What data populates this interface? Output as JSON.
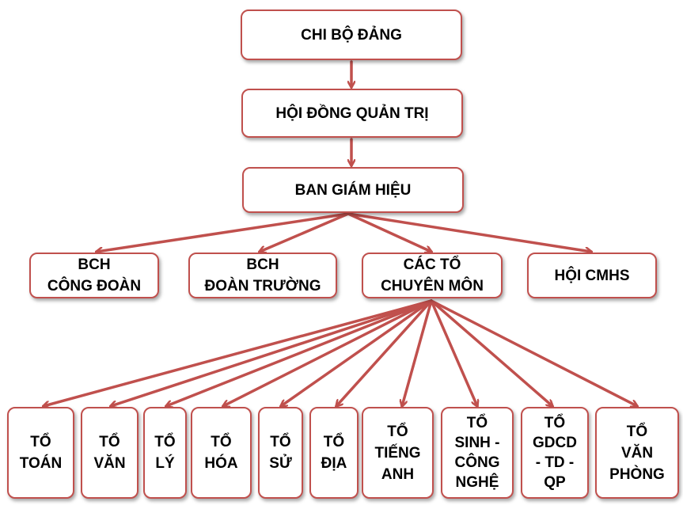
{
  "line_color": "#c0504d",
  "top_nodes": {
    "chi_bo": [
      "CHI BỘ ĐẢNG"
    ],
    "hoi_dong": [
      "HỘI ĐỒNG QUẢN TRỊ"
    ],
    "ban_giam_hieu": [
      "BAN GIÁM HIỆU"
    ]
  },
  "level2": [
    [
      "BCH",
      "CÔNG ĐOÀN"
    ],
    [
      "BCH",
      "ĐOÀN TRƯỜNG"
    ],
    [
      "CÁC TỔ",
      "CHUYÊN MÔN"
    ],
    [
      "HỘI CMHS"
    ]
  ],
  "level3": [
    [
      "TỔ",
      "TOÁN"
    ],
    [
      "TỔ",
      "VĂN"
    ],
    [
      "TỔ",
      "LÝ"
    ],
    [
      "TỔ",
      "HÓA"
    ],
    [
      "TỔ",
      "SỬ"
    ],
    [
      "TỔ",
      "ĐỊA"
    ],
    [
      "TỔ",
      "TIẾNG",
      "ANH"
    ],
    [
      "TỔ",
      "SINH -",
      "CÔNG",
      "NGHỆ"
    ],
    [
      "TỔ",
      "GDCD",
      "- TD -",
      "QP"
    ],
    [
      "TỔ",
      "VĂN",
      "PHÒNG"
    ]
  ]
}
